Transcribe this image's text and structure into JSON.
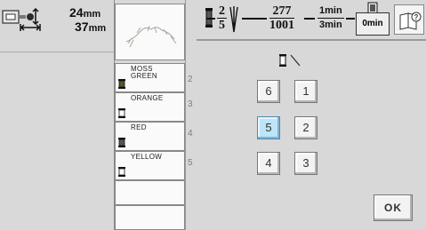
{
  "embroidery": {
    "size": {
      "width": "24",
      "height": "37",
      "unit": "mm"
    }
  },
  "status": {
    "thread_current": "2",
    "thread_total": "5",
    "stitch_current": "277",
    "stitch_total": "1001",
    "time_current": "1",
    "time_total": "3",
    "time_unit": "min",
    "remaining_time": "0",
    "remaining_unit": "min"
  },
  "thread_list": {
    "items": [
      {
        "number": "2",
        "name_lines": [
          "MOSS",
          "GREEN"
        ],
        "spool_fill": "#4f5a2c"
      },
      {
        "number": "3",
        "name_lines": [
          "ORANGE",
          ""
        ],
        "spool_fill": "#ffffff"
      },
      {
        "number": "4",
        "name_lines": [
          "RED",
          ""
        ],
        "spool_fill": "#555555"
      },
      {
        "number": "5",
        "name_lines": [
          "YELLOW",
          ""
        ],
        "spool_fill": "#ffffff"
      }
    ]
  },
  "needle_panel": {
    "buttons": [
      "6",
      "1",
      "5",
      "2",
      "4",
      "3"
    ],
    "selected": "5",
    "ok_label": "OK"
  },
  "colors": {
    "selected_button": "#bde4f7",
    "panel_bg": "#d8d8d8",
    "list_bg": "#fafafa"
  },
  "icons": [
    "embroidery-size-icon",
    "thread-spool-icon",
    "needle-icon",
    "bobbin-clock-icon",
    "help-book-icon"
  ]
}
